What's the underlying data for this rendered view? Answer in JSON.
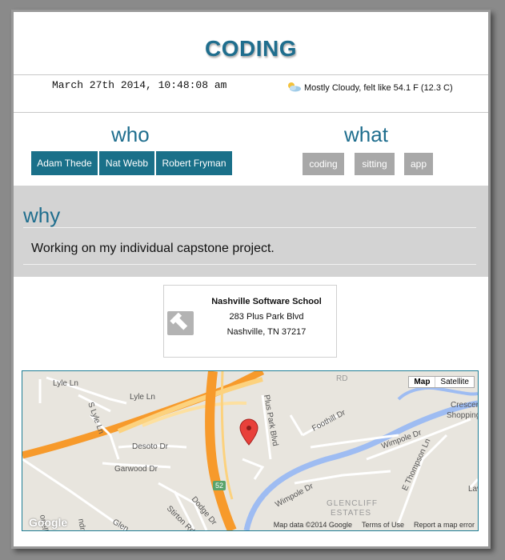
{
  "title": "CODING",
  "datetime": "March 27th 2014, 10:48:08 am",
  "weather": {
    "text": "Mostly Cloudy, felt like 54.1 F (12.3 C)",
    "icon": "partly-cloudy-icon"
  },
  "who": {
    "heading": "who",
    "people": [
      "Adam Thede",
      "Nat Webb",
      "Robert Fryman"
    ]
  },
  "what": {
    "heading": "what",
    "tags": [
      "coding",
      "sitting",
      "app"
    ]
  },
  "why": {
    "heading": "why",
    "text": "Working on my individual capstone project."
  },
  "location": {
    "name": "Nashville Software School",
    "street": "283 Plus Park Blvd",
    "city": "Nashville, TN 37217",
    "icon": "hammer-icon"
  },
  "map": {
    "type_buttons": [
      "Map",
      "Satellite"
    ],
    "footer": [
      "Map data ©2014 Google",
      "Terms of Use",
      "Report a map error"
    ],
    "logo": "Google",
    "labels": [
      "Lyle Ln",
      "Lyle Ln",
      "S Lyle Ln",
      "Desoto Dr",
      "Garwood Dr",
      "Plus Park Blvd",
      "Foothill Dr",
      "Wimpole Dr",
      "Wimpole Dr",
      "E Thompson Ln",
      "Crescent Pl",
      "Shopping Ce",
      "GLENCLIFF",
      "ESTATES",
      "Stirton Rd",
      "Dodge Dr",
      "52",
      "Glen",
      "Law",
      "RD",
      "ndra Dr",
      "onell"
    ],
    "colors": {
      "highway": "#f79a2b",
      "water": "#9ebcf2",
      "pin": "#e8403a"
    }
  }
}
